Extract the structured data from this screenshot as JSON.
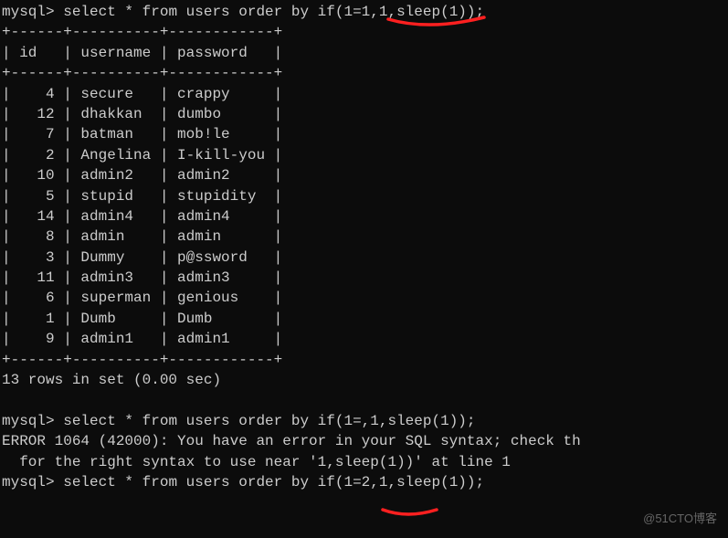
{
  "prompt": "mysql>",
  "query1": "select * from users order by if(1=1,1,sleep(1));",
  "table": {
    "border_top": "+------+----------+------------+",
    "header_row": "| id   | username | password   |",
    "border_mid": "+------+----------+------------+",
    "rows": [
      "|    4 | secure   | crappy     |",
      "|   12 | dhakkan  | dumbo      |",
      "|    7 | batman   | mob!le     |",
      "|    2 | Angelina | I-kill-you |",
      "|   10 | admin2   | admin2     |",
      "|    5 | stupid   | stupidity  |",
      "|   14 | admin4   | admin4     |",
      "|    8 | admin    | admin      |",
      "|    3 | Dummy    | p@ssword   |",
      "|   11 | admin3   | admin3     |",
      "|    6 | superman | genious    |",
      "|    1 | Dumb     | Dumb       |",
      "|    9 | admin1   | admin1     |"
    ],
    "border_bot": "+------+----------+------------+"
  },
  "result_msg": "13 rows in set (0.00 sec)",
  "query2": "select * from users order by if(1=,1,sleep(1));",
  "error_line1": "ERROR 1064 (42000): You have an error in your SQL syntax; check th",
  "error_line2": "  for the right syntax to use near '1,sleep(1))' at line 1",
  "query3": "select * from users order by if(1=2,1,sleep(1));",
  "watermark": "@51CTO博客"
}
